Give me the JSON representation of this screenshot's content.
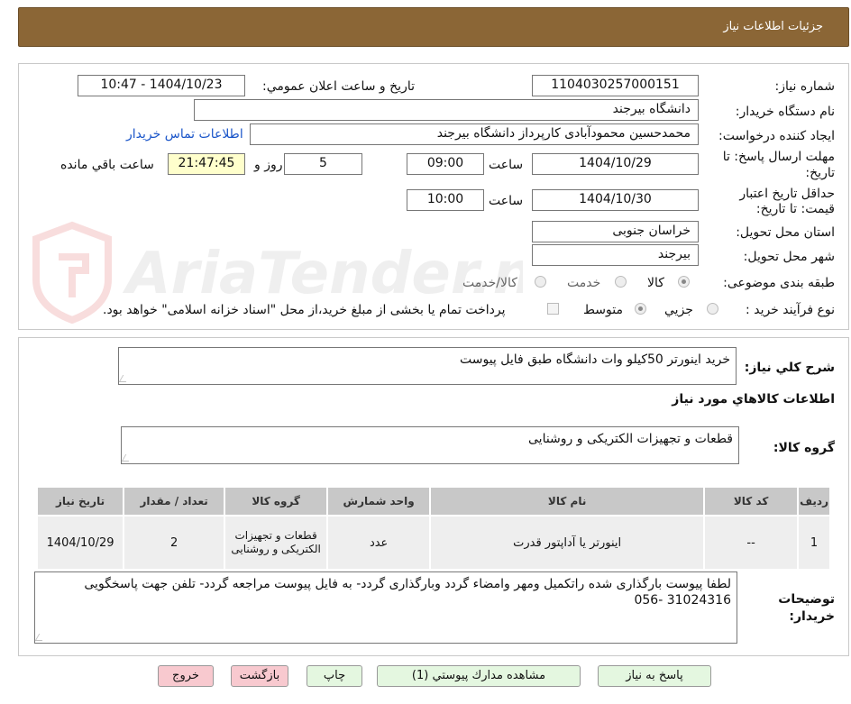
{
  "header": {
    "title": "جزئیات اطلاعات نیاز"
  },
  "fields": {
    "need_number_label": "شماره نیاز:",
    "need_number": "1104030257000151",
    "announce_label": "تاریخ و ساعت اعلان عمومي:",
    "announce_value": "1404/10/23 - 10:47",
    "buyer_org_label": "نام دستگاه خريدار:",
    "buyer_org": "دانشگاه بیرجند",
    "creator_label": "ايجاد كننده درخواست:",
    "creator": "محمدحسین محمودآبادی کارپرداز دانشگاه بیرجند",
    "contact_link": "اطلاعات تماس خریدار",
    "deadline_label_1": "مهلت ارسال پاسخ: تا",
    "deadline_label_2": "تاریخ:",
    "deadline_date": "1404/10/29",
    "time_label": "ساعت",
    "deadline_time": "09:00",
    "days_value": "5",
    "days_label": "روز و",
    "remaining_time": "21:47:45",
    "remaining_label": "ساعت باقي مانده",
    "validity_label_1": "حداقل تاريخ اعتبار",
    "validity_label_2": "قيمت: تا تاريخ:",
    "validity_date": "1404/10/30",
    "validity_time_label": "ساعت",
    "validity_time": "10:00",
    "province_label": "استان محل تحويل:",
    "province": "خراسان جنوبی",
    "city_label": "شهر محل تحويل:",
    "city": "بیرجند",
    "category_label": "طبقه بندی موضوعی:",
    "category_options": [
      "كالا",
      "خدمت",
      "كالا/خدمت"
    ],
    "process_label": "نوع فرآيند خريد :",
    "process_options": [
      "جزيي",
      "متوسط"
    ],
    "payment_note": "پرداخت تمام يا بخشی از مبلغ خريد،از محل \"اسناد خزانه اسلامی\" خواهد بود."
  },
  "description": {
    "label": "شرح كلي نياز:",
    "value": "خرید اینورتر 50کیلو وات دانشگاه طبق فایل پیوست"
  },
  "goods_section_title": "اطلاعات كالاهاي مورد نياز",
  "goods_group": {
    "label": "گروه كالا:",
    "value": "قطعات و تجهیزات الکتریکی و روشنایی"
  },
  "table": {
    "headers": [
      "رديف",
      "كد كالا",
      "نام كالا",
      "واحد شمارش",
      "گروه كالا",
      "تعداد / مقدار",
      "تاريخ نياز"
    ],
    "rows": [
      [
        "1",
        "--",
        "اینورتر یا آداپتور قدرت",
        "عدد",
        "قطعات و تجهیزات الکتریکی و روشنایی",
        "2",
        "1404/10/29"
      ]
    ]
  },
  "buyer_notes": {
    "label_1": "توضيحات",
    "label_2": "خريدار:",
    "value": "لطفا پیوست بارگذاری شده راتکمیل ومهر وامضاء گردد وبارگذاری گردد- به فایل پیوست مراجعه گردد- تلفن جهت پاسخگویی 31024316 -056"
  },
  "buttons": {
    "reply": "پاسخ به نياز",
    "view_docs": "مشاهده مدارك پيوستي (1)",
    "print": "چاپ",
    "back": "بازگشت",
    "exit": "خروج"
  },
  "watermark": "AriaTender.net",
  "colors": {
    "header_bg": "#8B6636",
    "link": "#1a55c9",
    "remaining_bg": "#FFFFCC",
    "table_header": "#c8c8c8"
  }
}
